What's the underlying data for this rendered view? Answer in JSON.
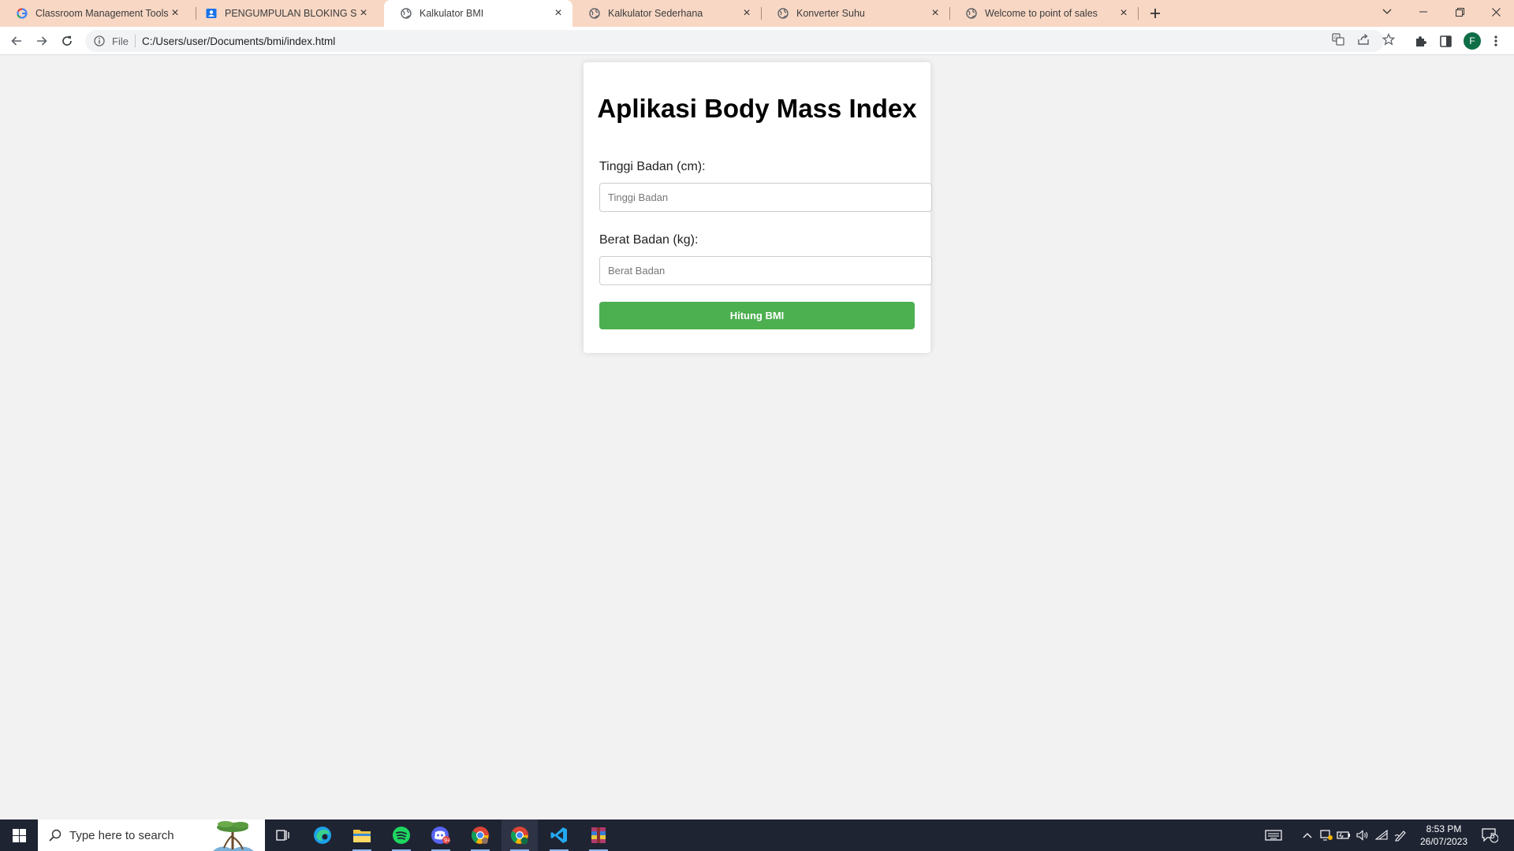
{
  "browser": {
    "tabs": [
      {
        "title": "Classroom Management Tools &",
        "favicon": "google-icon",
        "active": false
      },
      {
        "title": "PENGUMPULAN BLOKING SELAS",
        "favicon": "user-badge-icon",
        "active": false
      },
      {
        "title": "Kalkulator BMI",
        "favicon": "globe-icon",
        "active": true
      },
      {
        "title": "Kalkulator Sederhana",
        "favicon": "globe-icon",
        "active": false
      },
      {
        "title": "Konverter Suhu",
        "favicon": "globe-icon",
        "active": false
      },
      {
        "title": "Welcome to point of sales",
        "favicon": "globe-icon",
        "active": false
      }
    ],
    "address_bar": {
      "scheme_label": "File",
      "url": "C:/Users/user/Documents/bmi/index.html"
    },
    "profile_initial": "F"
  },
  "page": {
    "title": "Aplikasi Body Mass Index",
    "height_label": "Tinggi Badan (cm):",
    "height_placeholder": "Tinggi Badan",
    "height_value": "",
    "weight_label": "Berat Badan (kg):",
    "weight_placeholder": "Berat Badan",
    "weight_value": "",
    "button_label": "Hitung BMI",
    "button_color": "#4caf50"
  },
  "taskbar": {
    "search_placeholder": "Type here to search",
    "apps": [
      "task-view-icon",
      "edge-icon",
      "file-explorer-icon",
      "spotify-icon",
      "discord-icon",
      "chrome-icon",
      "chrome-profile-icon",
      "vscode-icon",
      "winrar-icon"
    ],
    "time": "8:53 PM",
    "date": "26/07/2023",
    "notification_count": "5"
  }
}
